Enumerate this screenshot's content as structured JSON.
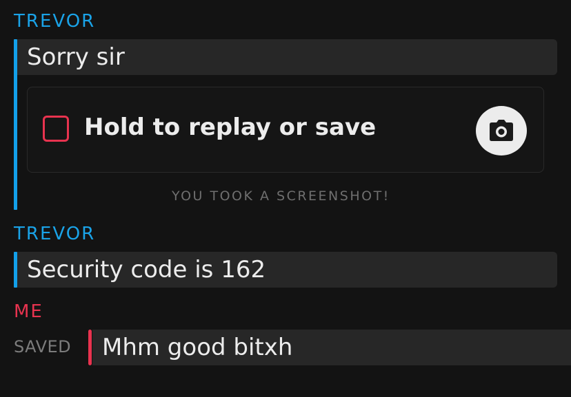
{
  "messages": [
    {
      "sender": "TREVOR",
      "text": "Sorry sir",
      "snap": {
        "label": "Hold to replay or save",
        "camera_icon": "camera-icon",
        "note": "YOU TOOK A SCREENSHOT!"
      }
    },
    {
      "sender": "TREVOR",
      "text": "Security code is 162"
    },
    {
      "sender": "ME",
      "status": "SAVED",
      "text": "Mhm good bitxh"
    }
  ],
  "colors": {
    "background": "#131313",
    "trevor_accent": "#13a0ea",
    "me_accent": "#e8334f",
    "bubble": "#272727",
    "text": "#ececec",
    "muted": "#6f6f6f"
  }
}
